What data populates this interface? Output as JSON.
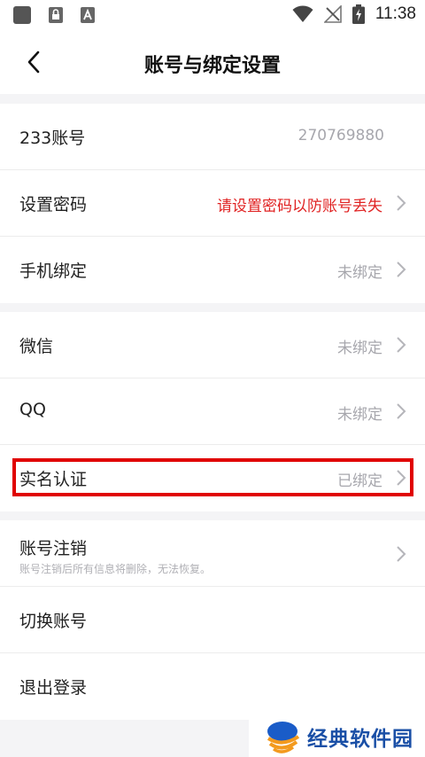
{
  "status_bar": {
    "time": "11:38"
  },
  "header": {
    "title": "账号与绑定设置"
  },
  "groups": [
    {
      "rows": [
        {
          "label": "233账号",
          "value": "270769880"
        },
        {
          "label": "设置密码",
          "value": "请设置密码以防账号丢失"
        },
        {
          "label": "手机绑定",
          "value": "未绑定"
        }
      ]
    },
    {
      "rows": [
        {
          "label": "微信",
          "value": "未绑定"
        },
        {
          "label": "QQ",
          "value": "未绑定"
        },
        {
          "label": "实名认证",
          "value": "已绑定"
        }
      ]
    },
    {
      "rows": [
        {
          "label": "账号注销",
          "sub": "账号注销后所有信息将删除，无法恢复。"
        },
        {
          "label": "切换账号"
        },
        {
          "label": "退出登录"
        }
      ]
    }
  ],
  "watermark": {
    "text": "经典软件园"
  },
  "colors": {
    "warning": "#e02222",
    "highlight": "#e00000",
    "muted": "#a7a7ad",
    "watermark": "#1a4fa6"
  }
}
